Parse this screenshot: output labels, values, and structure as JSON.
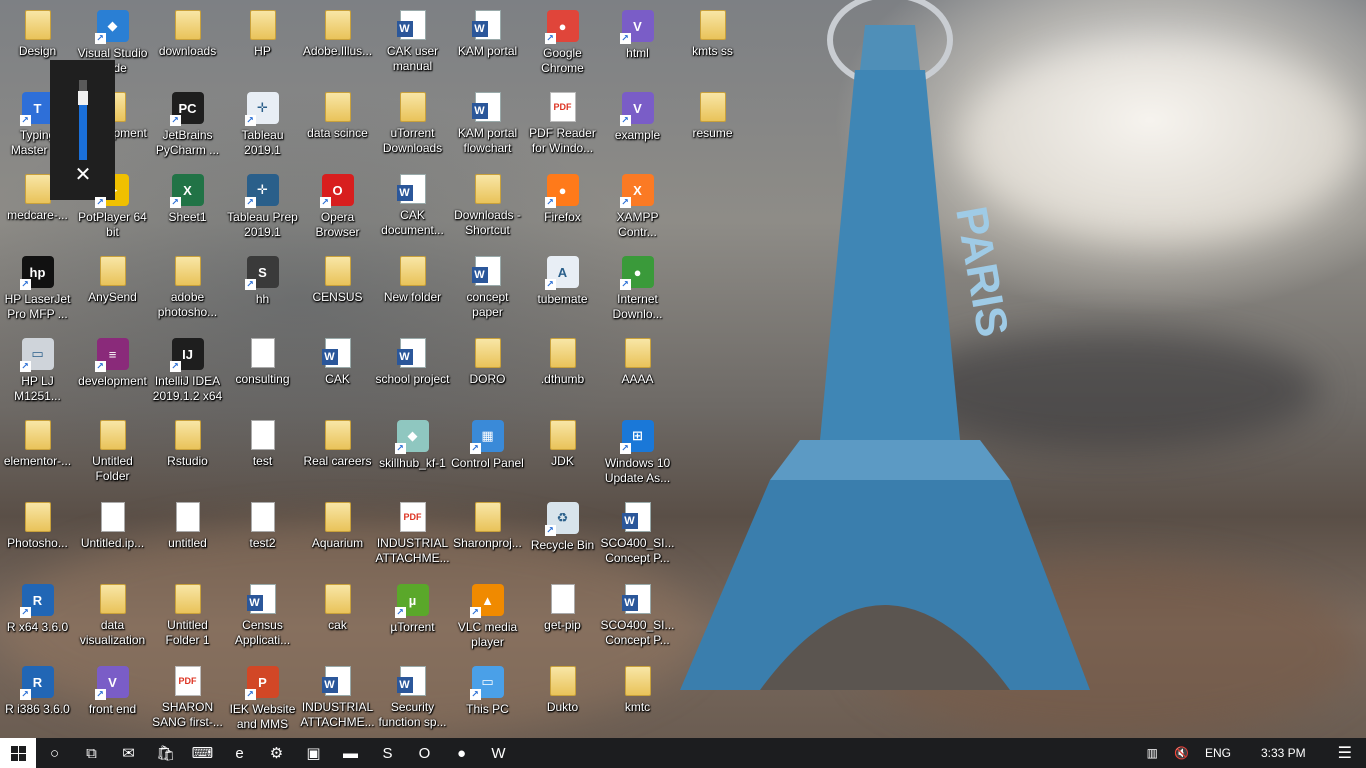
{
  "desktop": {
    "icons": [
      {
        "label": "Design",
        "kind": "folder"
      },
      {
        "label": "Visual Studio Code",
        "kind": "app",
        "color": "#2a7fd4",
        "glyph": "◆"
      },
      {
        "label": "downloads",
        "kind": "folder"
      },
      {
        "label": "HP",
        "kind": "folder"
      },
      {
        "label": "Adobe.Illus...",
        "kind": "folder"
      },
      {
        "label": "CAK user manual",
        "kind": "word"
      },
      {
        "label": "KAM portal",
        "kind": "word"
      },
      {
        "label": "Google Chrome",
        "kind": "app",
        "color": "#e0453a",
        "glyph": "●"
      },
      {
        "label": "html",
        "kind": "app",
        "color": "#7a5dc7",
        "glyph": "V"
      },
      {
        "label": "kmts ss",
        "kind": "folder"
      },
      {
        "label": "Typing Master 10",
        "kind": "app",
        "color": "#2e6fd8",
        "glyph": "T"
      },
      {
        "label": "development",
        "kind": "folder"
      },
      {
        "label": "JetBrains PyCharm ...",
        "kind": "app",
        "color": "#1e1e1e",
        "glyph": "PC"
      },
      {
        "label": "Tableau 2019.1",
        "kind": "app",
        "color": "#e8eef5",
        "glyph": "✛"
      },
      {
        "label": "data scince",
        "kind": "folder"
      },
      {
        "label": "uTorrent Downloads",
        "kind": "folder"
      },
      {
        "label": "KAM portal flowchart",
        "kind": "word"
      },
      {
        "label": "PDF Reader for Windo...",
        "kind": "pdf"
      },
      {
        "label": "example",
        "kind": "app",
        "color": "#7a5dc7",
        "glyph": "V"
      },
      {
        "label": "resume",
        "kind": "folder"
      },
      {
        "label": "medcare-...",
        "kind": "folder"
      },
      {
        "label": "PotPlayer 64 bit",
        "kind": "app",
        "color": "#f0c000",
        "glyph": "▶"
      },
      {
        "label": "Sheet1",
        "kind": "app",
        "color": "#217346",
        "glyph": "X"
      },
      {
        "label": "Tableau Prep 2019.1",
        "kind": "app",
        "color": "#2a5f8a",
        "glyph": "✛"
      },
      {
        "label": "Opera Browser",
        "kind": "app",
        "color": "#d81e1e",
        "glyph": "O"
      },
      {
        "label": "CAK document...",
        "kind": "word"
      },
      {
        "label": "Downloads - Shortcut",
        "kind": "folder"
      },
      {
        "label": "Firefox",
        "kind": "app",
        "color": "#ff7a1a",
        "glyph": "●"
      },
      {
        "label": "XAMPP Contr...",
        "kind": "app",
        "color": "#fb7a24",
        "glyph": "X"
      },
      {
        "label": "HP LaserJet Pro MFP ...",
        "kind": "app",
        "color": "#111",
        "glyph": "hp"
      },
      {
        "label": "AnySend",
        "kind": "folder"
      },
      {
        "label": "adobe photosho...",
        "kind": "folder"
      },
      {
        "label": "hh",
        "kind": "app",
        "color": "#3a3a3a",
        "glyph": "S"
      },
      {
        "label": "CENSUS",
        "kind": "folder"
      },
      {
        "label": "New folder",
        "kind": "folder"
      },
      {
        "label": "concept paper",
        "kind": "word"
      },
      {
        "label": "tubemate",
        "kind": "app",
        "color": "#e8eef5",
        "glyph": "A"
      },
      {
        "label": "Internet Downlo...",
        "kind": "app",
        "color": "#3a9a3a",
        "glyph": "●"
      },
      {
        "label": "HP LJ M1251...",
        "kind": "app",
        "color": "#cfd4da",
        "glyph": "▭"
      },
      {
        "label": "development",
        "kind": "app",
        "color": "#8a2a7a",
        "glyph": "≡"
      },
      {
        "label": "IntelliJ IDEA 2019.1.2 x64",
        "kind": "app",
        "color": "#1e1e1e",
        "glyph": "IJ"
      },
      {
        "label": "consulting",
        "kind": "doc"
      },
      {
        "label": "CAK",
        "kind": "word"
      },
      {
        "label": "school project",
        "kind": "word"
      },
      {
        "label": "DORO",
        "kind": "folder"
      },
      {
        "label": ".dthumb",
        "kind": "folder"
      },
      {
        "label": "AAAA",
        "kind": "folder"
      },
      {
        "label": "elementor-...",
        "kind": "folder"
      },
      {
        "label": "Untitled Folder",
        "kind": "folder"
      },
      {
        "label": "Rstudio",
        "kind": "folder"
      },
      {
        "label": "test",
        "kind": "doc"
      },
      {
        "label": "Real careers",
        "kind": "folder"
      },
      {
        "label": "skillhub_kf-1",
        "kind": "app",
        "color": "#8fc7c0",
        "glyph": "◆"
      },
      {
        "label": "Control Panel",
        "kind": "app",
        "color": "#3a8ad8",
        "glyph": "▦"
      },
      {
        "label": "JDK",
        "kind": "folder"
      },
      {
        "label": "Windows 10 Update As...",
        "kind": "app",
        "color": "#1a78d8",
        "glyph": "⊞"
      },
      {
        "label": "Photosho...",
        "kind": "folder"
      },
      {
        "label": "Untitled.ip...",
        "kind": "doc"
      },
      {
        "label": "untitled",
        "kind": "doc"
      },
      {
        "label": "test2",
        "kind": "doc"
      },
      {
        "label": "Aquarium",
        "kind": "folder"
      },
      {
        "label": "INDUSTRIAL ATTACHME...",
        "kind": "pdf"
      },
      {
        "label": "Sharonproj...",
        "kind": "folder"
      },
      {
        "label": "Recycle Bin",
        "kind": "app",
        "color": "#d8e4ec",
        "glyph": "♻"
      },
      {
        "label": "SCO400_SI... Concept P...",
        "kind": "word"
      },
      {
        "label": "R x64 3.6.0",
        "kind": "app",
        "color": "#2166b5",
        "glyph": "R"
      },
      {
        "label": "data visualization",
        "kind": "folder"
      },
      {
        "label": "Untitled Folder 1",
        "kind": "folder"
      },
      {
        "label": "Census Applicati...",
        "kind": "word"
      },
      {
        "label": "cak",
        "kind": "folder"
      },
      {
        "label": "µTorrent",
        "kind": "app",
        "color": "#5aa82a",
        "glyph": "µ"
      },
      {
        "label": "VLC media player",
        "kind": "app",
        "color": "#f08a00",
        "glyph": "▲"
      },
      {
        "label": "get-pip",
        "kind": "doc"
      },
      {
        "label": "SCO400_SI... Concept P...",
        "kind": "word"
      },
      {
        "label": "R i386 3.6.0",
        "kind": "app",
        "color": "#2166b5",
        "glyph": "R"
      },
      {
        "label": "front end",
        "kind": "app",
        "color": "#7a5dc7",
        "glyph": "V"
      },
      {
        "label": "SHARON SANG first-...",
        "kind": "pdf"
      },
      {
        "label": "IEK Website and MMS",
        "kind": "app",
        "color": "#d24726",
        "glyph": "P"
      },
      {
        "label": "INDUSTRIAL ATTACHME...",
        "kind": "word"
      },
      {
        "label": "Security function sp...",
        "kind": "word"
      },
      {
        "label": "This PC",
        "kind": "app",
        "color": "#4aa0e8",
        "glyph": "▭"
      },
      {
        "label": "Dukto",
        "kind": "folder"
      },
      {
        "label": "kmtc",
        "kind": "folder"
      }
    ]
  },
  "volume": {
    "level": 0.78,
    "mute_glyph": "✕"
  },
  "taskbar": {
    "apps": [
      {
        "name": "search-icon",
        "glyph": "○"
      },
      {
        "name": "task-view-icon",
        "glyph": "⧉"
      },
      {
        "name": "mail-icon",
        "glyph": "✉"
      },
      {
        "name": "store-icon",
        "glyph": "🛍"
      },
      {
        "name": "keyboard-icon",
        "glyph": "⌨"
      },
      {
        "name": "edge-icon",
        "glyph": "e"
      },
      {
        "name": "settings-icon",
        "glyph": "⚙"
      },
      {
        "name": "remote-desktop-icon",
        "glyph": "▣"
      },
      {
        "name": "file-explorer-icon",
        "glyph": "▬"
      },
      {
        "name": "skype-icon",
        "glyph": "S"
      },
      {
        "name": "opera-icon",
        "glyph": "O"
      },
      {
        "name": "chrome-icon",
        "glyph": "●"
      },
      {
        "name": "word-icon",
        "glyph": "W"
      }
    ],
    "tray": {
      "language": "ENG",
      "time": "3:33 PM",
      "network_glyph": "▥",
      "volume_glyph": "🔇",
      "notification_glyph": "☰"
    }
  }
}
